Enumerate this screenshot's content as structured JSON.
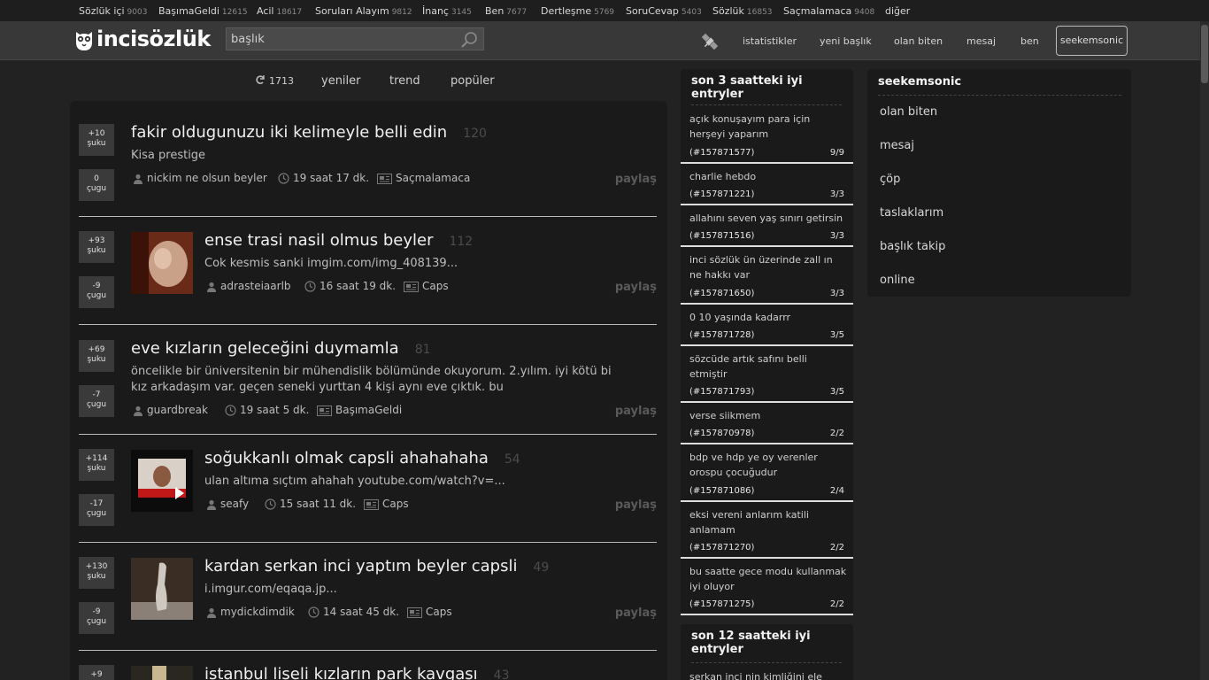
{
  "categories": [
    {
      "name": "Sözlük içi",
      "count": "9003"
    },
    {
      "name": "BaşımaGeldi",
      "count": "12615"
    },
    {
      "name": "Acil",
      "count": "18617"
    },
    {
      "name": "Soruları Alayım",
      "count": "9812"
    },
    {
      "name": "İnanç",
      "count": "3145"
    },
    {
      "name": "Ben",
      "count": "7677"
    },
    {
      "name": "Dertleşme",
      "count": "5769"
    },
    {
      "name": "SoruCevap",
      "count": "5403"
    },
    {
      "name": "Sözlük",
      "count": "16853"
    },
    {
      "name": "Saçmalamaca",
      "count": "9408"
    },
    {
      "name": "diğer",
      "count": ""
    }
  ],
  "header": {
    "logo_text": "incisözlük",
    "search_placeholder": "başlık",
    "nav": [
      "istatistikler",
      "yeni başlık",
      "olan biten",
      "mesaj",
      "ben"
    ],
    "user": "seekemsonic"
  },
  "tabs": {
    "refresh_count": "1713",
    "items": [
      "yeniler",
      "trend",
      "popüler"
    ]
  },
  "entries": [
    {
      "up": "+10",
      "up_label": "şuku",
      "down": "0",
      "down_label": "çugu",
      "title": "fakir oldugunuzu iki kelimeyle belli edin",
      "num": "120",
      "excerpt": "Kisa prestige",
      "author": "nickim ne olsun beyler",
      "time": "19 saat 17 dk.",
      "category": "Saçmalamaca",
      "share": "paylaş"
    },
    {
      "up": "+93",
      "up_label": "şuku",
      "down": "-9",
      "down_label": "çugu",
      "title": "ense trasi nasil olmus beyler",
      "num": "112",
      "excerpt": "Cok kesmis sanki imgim.com/img_408139...",
      "author": "adrasteiaarlb",
      "time": "16 saat 19 dk.",
      "category": "Caps",
      "share": "paylaş"
    },
    {
      "up": "+69",
      "up_label": "şuku",
      "down": "-7",
      "down_label": "çugu",
      "title": "eve kızların geleceğini duymamla",
      "num": "81",
      "excerpt": "öncelikle bir üniversitenin bir mühendislik bölümünde okuyorum. 2.yılım. iyi kötü bi kız arkadaşım var. geçen seneki yurttan 4 kişi aynı eve çıktık. bu",
      "author": "guardbreak",
      "time": "19 saat 5 dk.",
      "category": "BaşımaGeldi",
      "share": "paylaş"
    },
    {
      "up": "+114",
      "up_label": "şuku",
      "down": "-17",
      "down_label": "çugu",
      "title": "soğukkanlı olmak capsli ahahahaha",
      "num": "54",
      "excerpt": "ulan altıma sıçtım ahahah youtube.com/watch?v=...",
      "author": "seafy",
      "time": "15 saat 11 dk.",
      "category": "Caps",
      "share": "paylaş"
    },
    {
      "up": "+130",
      "up_label": "şuku",
      "down": "-9",
      "down_label": "çugu",
      "title": "kardan serkan inci yaptım beyler capsli",
      "num": "49",
      "excerpt": "i.imgur.com/eqaqa.jp...",
      "author": "mydickdimdik",
      "time": "14 saat 45 dk.",
      "category": "Caps",
      "share": "paylaş"
    },
    {
      "up": "+9",
      "up_label": "",
      "down": "",
      "down_label": "",
      "title": "istanbul liseli kızların park kavgası",
      "num": "43",
      "excerpt": "",
      "author": "",
      "time": "",
      "category": "",
      "share": ""
    }
  ],
  "side3": {
    "title": "son 3 saatteki iyi entryler",
    "items": [
      {
        "text": "açık konuşayım para için herşeyi yaparım",
        "id": "(#157871577)",
        "count": "9/9"
      },
      {
        "text": "charlie hebdo",
        "id": "(#157871221)",
        "count": "3/3"
      },
      {
        "text": "allahını seven yaş sınırı getirsin",
        "id": "(#157871516)",
        "count": "3/3"
      },
      {
        "text": "inci sözlük ün üzerinde zall ın ne hakkı var",
        "id": "(#157871650)",
        "count": "3/3"
      },
      {
        "text": "0 10 yaşında kadarrr",
        "id": "(#157871728)",
        "count": "3/5"
      },
      {
        "text": "sözcüde artık safını belli etmiştir",
        "id": "(#157871793)",
        "count": "3/5"
      },
      {
        "text": "verse siikmem",
        "id": "(#157870978)",
        "count": "2/2"
      },
      {
        "text": "bdp ve hdp ye oy verenler orospu çocuğudur",
        "id": "(#157871086)",
        "count": "2/4"
      },
      {
        "text": "eksi vereni anlarım katili anlamam",
        "id": "(#157871270)",
        "count": "2/2"
      },
      {
        "text": "bu saatte gece modu kullanmak iyi oluyor",
        "id": "(#157871275)",
        "count": "2/2"
      }
    ]
  },
  "side12": {
    "title": "son 12 saatteki iyi entryler",
    "first": "serkan inci nin kimliğini ele"
  },
  "userbox": {
    "name": "seekemsonic",
    "links": [
      "olan biten",
      "mesaj",
      "çöp",
      "taslaklarım",
      "başlık takip",
      "online"
    ]
  }
}
